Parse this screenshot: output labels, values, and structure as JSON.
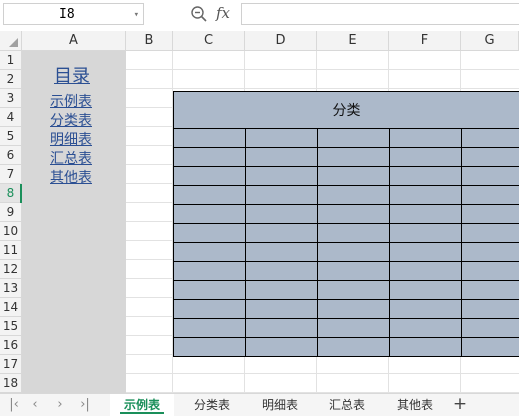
{
  "formula_bar": {
    "name_box": "I8",
    "fx_label": "fx",
    "formula_value": ""
  },
  "columns": [
    "A",
    "B",
    "C",
    "D",
    "E",
    "F",
    "G"
  ],
  "rows": [
    "1",
    "2",
    "3",
    "4",
    "5",
    "6",
    "7",
    "8",
    "9",
    "10",
    "11",
    "12",
    "13",
    "14",
    "15",
    "16",
    "17",
    "18"
  ],
  "active_row": "8",
  "toc": {
    "title": "目录",
    "links": [
      "示例表",
      "分类表",
      "明细表",
      "汇总表",
      "其他表"
    ]
  },
  "table": {
    "header": "分类"
  },
  "sheet_tabs": {
    "tabs": [
      "示例表",
      "分类表",
      "明细表",
      "汇总表",
      "其他表"
    ],
    "active": "示例表",
    "add": "+"
  },
  "colors": {
    "accent": "#1a8f5a",
    "table_fill": "#acb9ca",
    "toc_bg": "#d7d7d7",
    "link": "#2b4f93"
  }
}
